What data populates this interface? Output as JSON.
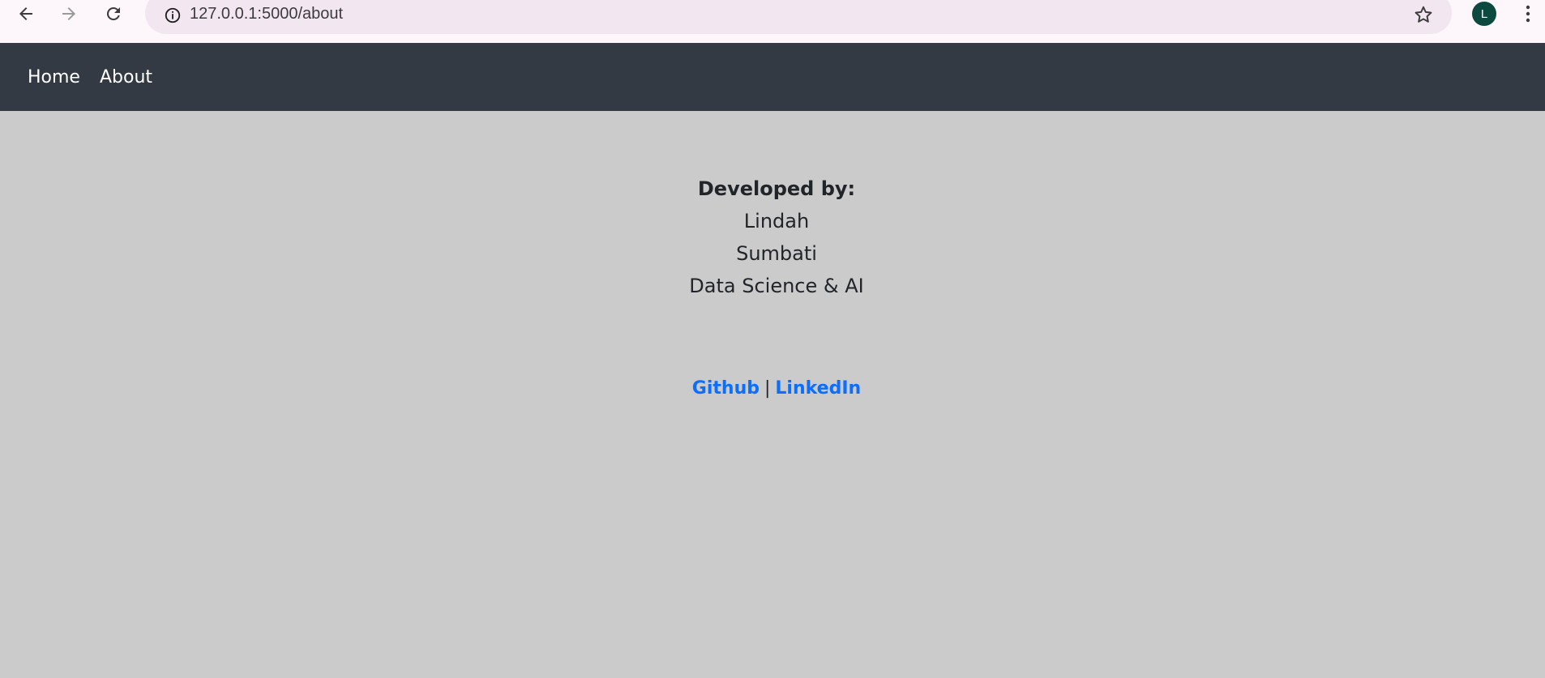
{
  "browser": {
    "url": "127.0.0.1:5000/about",
    "profile_initial": "L",
    "icons": {
      "back": "arrow-left-icon",
      "forward": "arrow-right-icon",
      "reload": "reload-icon",
      "site_info": "info-circle-icon",
      "bookmark": "star-icon",
      "menu": "vertical-dots-icon"
    },
    "colors": {
      "toolbar_bg": "#fdf6fb",
      "omnibox_bg": "#f2e6f0",
      "avatar_bg": "#0c4a3f"
    }
  },
  "navbar": {
    "links": [
      {
        "label": "Home"
      },
      {
        "label": "About"
      }
    ],
    "colors": {
      "bg": "#343a44",
      "text": "#ffffff"
    }
  },
  "about": {
    "heading": "Developed by:",
    "first_name": "Lindah",
    "last_name": "Sumbati",
    "field": "Data Science & AI"
  },
  "links": {
    "github": "Github",
    "separator": "|",
    "linkedin": "LinkedIn",
    "colors": {
      "link": "#0d6efd"
    }
  },
  "page": {
    "colors": {
      "bg": "#cbcbcb",
      "text": "#212529"
    }
  }
}
